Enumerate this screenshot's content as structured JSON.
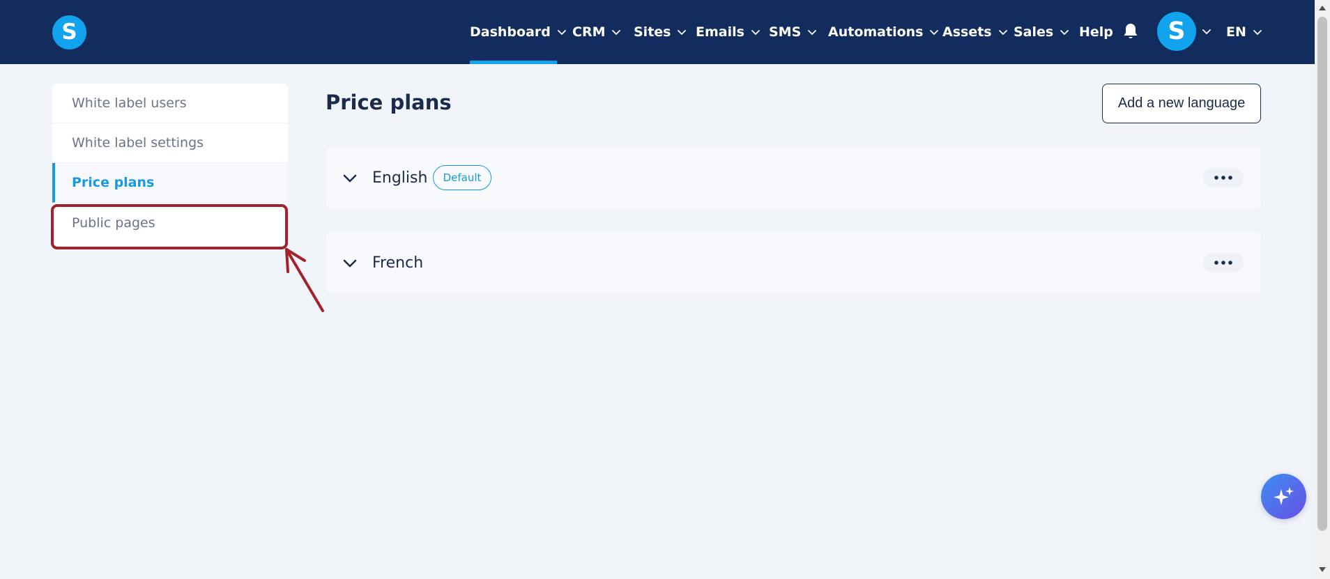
{
  "logo": {
    "letter": "S"
  },
  "nav": {
    "items": [
      {
        "label": "Dashboard",
        "has_dropdown": true,
        "active": true
      },
      {
        "label": "CRM",
        "has_dropdown": true
      },
      {
        "label": "Sites",
        "has_dropdown": true
      },
      {
        "label": "Emails",
        "has_dropdown": true
      },
      {
        "label": "SMS",
        "has_dropdown": true
      },
      {
        "label": "Automations",
        "has_dropdown": true
      },
      {
        "label": "Assets",
        "has_dropdown": true
      },
      {
        "label": "Sales",
        "has_dropdown": true
      },
      {
        "label": "Help",
        "has_dropdown": false
      }
    ],
    "avatar_letter": "S",
    "language": "EN"
  },
  "sidebar": {
    "items": [
      {
        "label": "White label users"
      },
      {
        "label": "White label settings"
      },
      {
        "label": "Price plans",
        "active": true
      },
      {
        "label": "Public pages",
        "highlighted": true
      }
    ]
  },
  "main": {
    "title": "Price plans",
    "add_button_label": "Add a new language",
    "languages": [
      {
        "name": "English",
        "badge": "Default"
      },
      {
        "name": "French"
      }
    ]
  },
  "colors": {
    "nav_bg": "#122c5e",
    "accent": "#1699e0",
    "annotation": "#a3212a",
    "text_dark": "#1a2b4c"
  },
  "icons": {
    "nav_dropdown": "chevron-down-icon",
    "notifications": "bell-icon",
    "expand": "chevron-down-icon",
    "more": "more-horizontal-icon",
    "ai": "sparkles-icon"
  }
}
